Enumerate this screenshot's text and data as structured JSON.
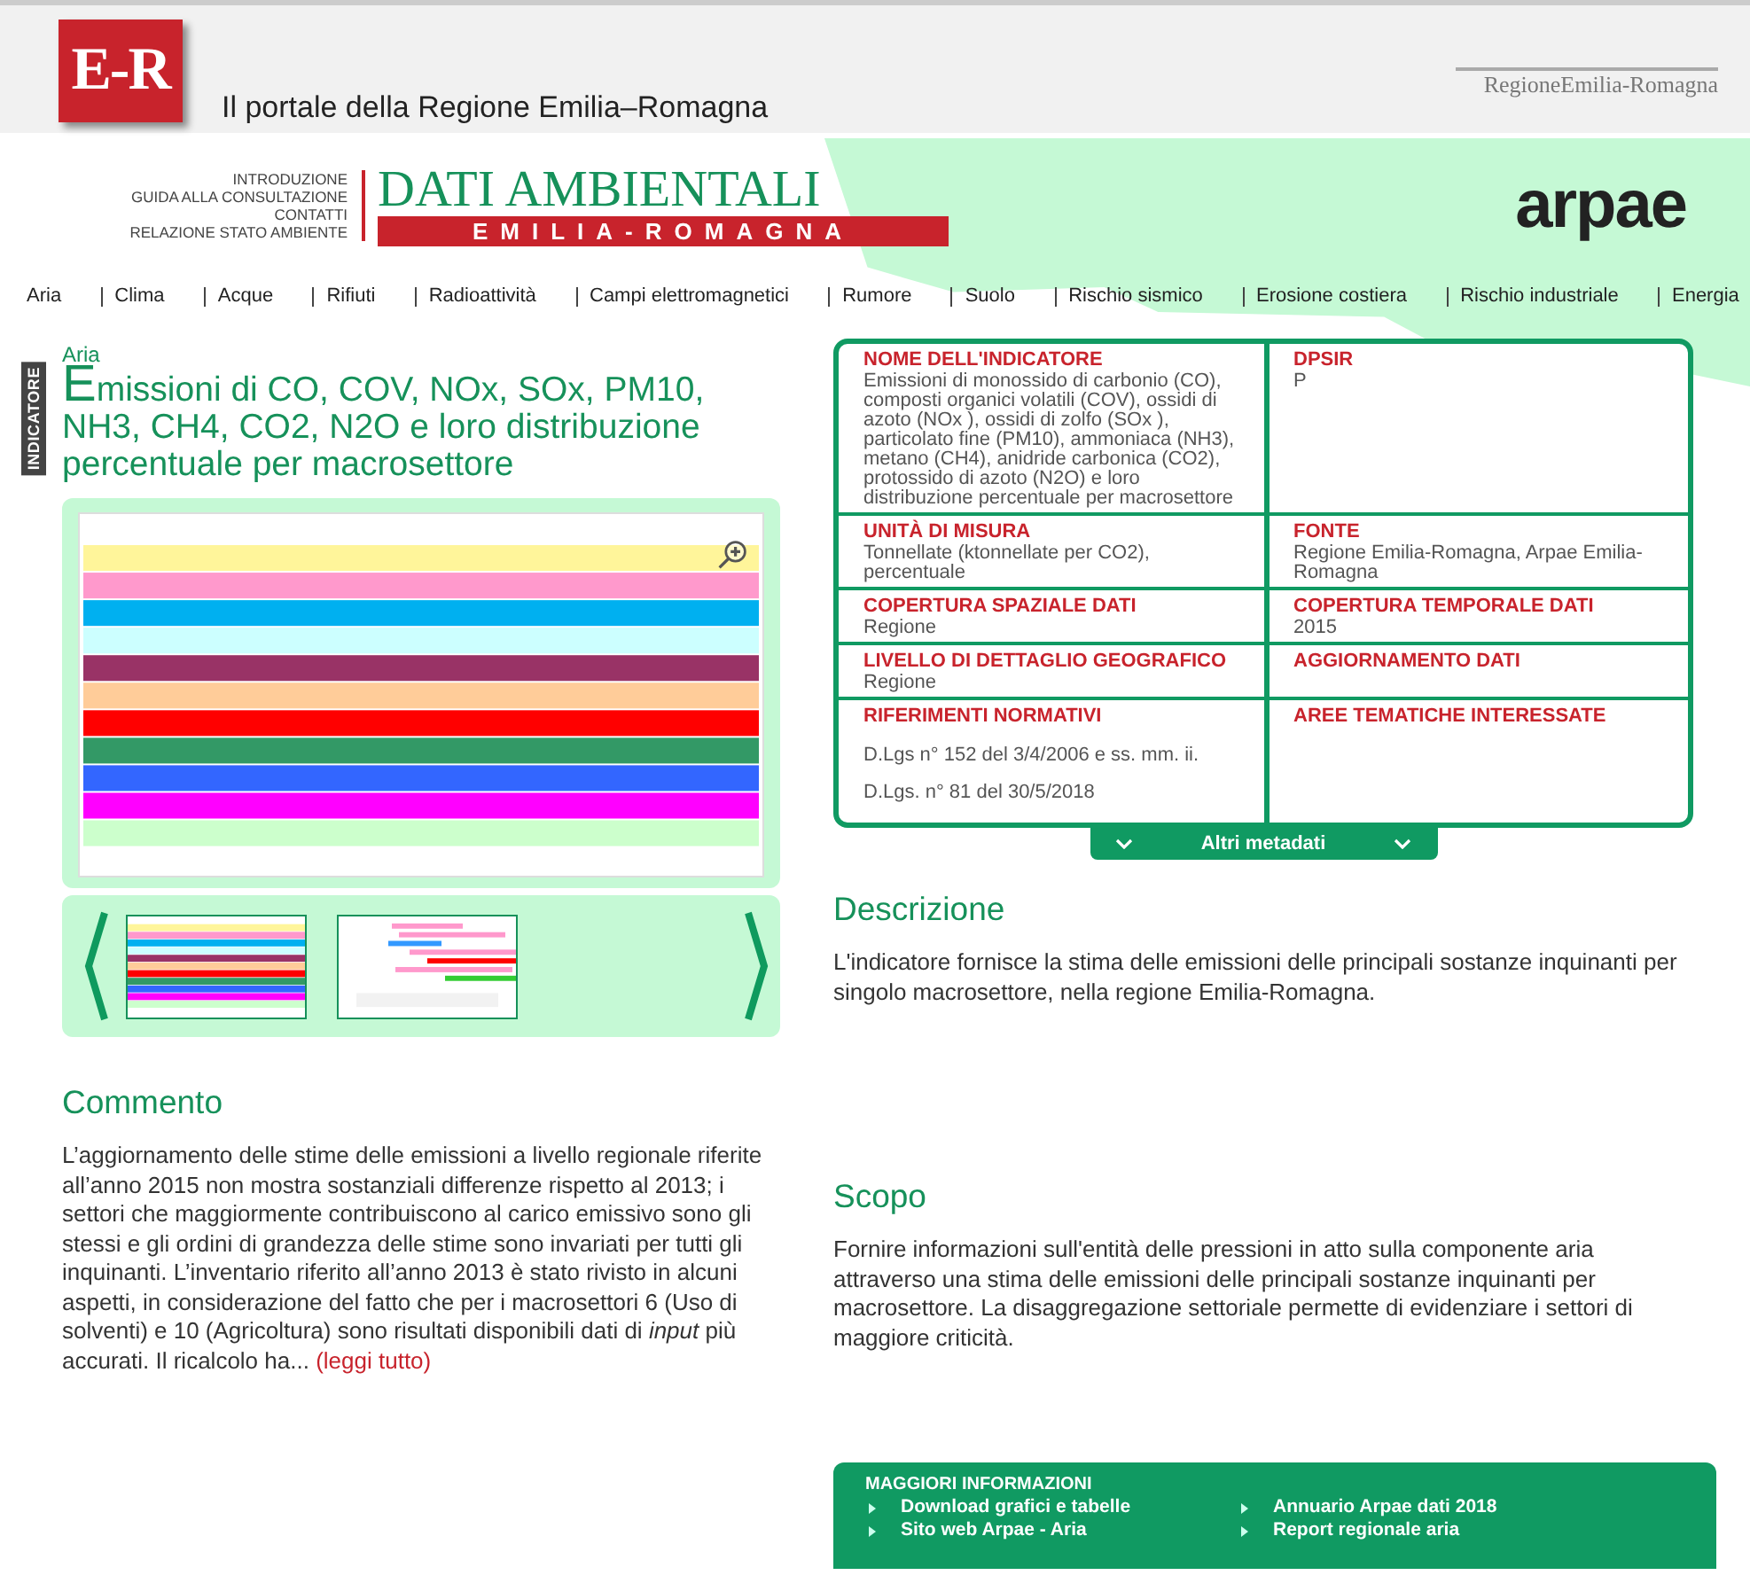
{
  "portal": {
    "logo_mark": "E-R",
    "title": "Il portale della Regione Emilia–Romagna",
    "region_logo": "RegioneEmilia-Romagna"
  },
  "site": {
    "links": [
      "INTRODUZIONE",
      "GUIDA ALLA CONSULTAZIONE",
      "CONTATTI",
      "RELAZIONE STATO AMBIENTE"
    ],
    "title": "DATI AMBIENTALI",
    "subtitle": "EMILIA-ROMAGNA",
    "agency_logo": "arpae"
  },
  "nav": [
    "Aria",
    "Clima",
    "Acque",
    "Rifiuti",
    "Radioattività",
    "Campi elettromagnetici",
    "Rumore",
    "Suolo",
    "Rischio sismico",
    "Erosione costiera",
    "Rischio industriale",
    "Energia"
  ],
  "indicator": {
    "side_label": "INDICATORE",
    "topic": "Aria",
    "title": "Emissioni di CO, COV, NOx, SOx, PM10, NH3, CH4, CO2, N2O e loro distribuzione percentuale per macrosettore"
  },
  "metadata": [
    {
      "label": "NOME DELL'INDICATORE",
      "lines": [
        "Emissioni di monossido di carbonio (CO), composti organici volatili (COV), ossidi di azoto (NOx ), ossidi di zolfo (SOx ), particolato fine (PM10), ammoniaca (NH3), metano (CH4), anidride carbonica (CO2), protossido di azoto (N2O) e loro distribuzione percentuale per macrosettore"
      ]
    },
    {
      "label": "DPSIR",
      "lines": [
        "P"
      ]
    },
    {
      "label": "UNITÀ DI MISURA",
      "lines": [
        "Tonnellate (ktonnellate per CO2), percentuale"
      ]
    },
    {
      "label": "FONTE",
      "lines": [
        "Regione Emilia-Romagna, Arpae Emilia-Romagna"
      ]
    },
    {
      "label": "COPERTURA SPAZIALE DATI",
      "lines": [
        "Regione"
      ]
    },
    {
      "label": "COPERTURA TEMPORALE DATI",
      "lines": [
        "2015"
      ]
    },
    {
      "label": "LIVELLO DI DETTAGLIO GEOGRAFICO",
      "lines": [
        "Regione"
      ]
    },
    {
      "label": "AGGIORNAMENTO DATI"
    },
    {
      "label": "RIFERIMENTI NORMATIVI",
      "kind": "list",
      "lines": [
        "D.Lgs n° 152 del 3/4/2006 e ss. mm. ii.",
        "D.Lgs. n° 81 del 30/5/2018"
      ]
    },
    {
      "label": "AREE TEMATICHE INTERESSATE"
    }
  ],
  "more_metadata_button": "Altri metadati",
  "comment": {
    "heading": "Commento",
    "text": "L’aggiornamento delle stime delle emissioni a livello regionale riferite all’anno 2015 non mostra sostanziali differenze rispetto al 2013; i settori che maggiormente contribuiscono al carico emissivo sono gli stessi e gli ordini di grandezza delle stime sono invariati per tutti gli inquinanti. L’inventario riferito all’anno 2013 è stato rivisto in alcuni aspetti, in considerazione del fatto che per i macrosettori 6 (Uso di solventi) e 10 (Agricoltura) sono risultati disponibili dati di *input* più accurati. Il ricalcolo ha...",
    "link": "(leggi tutto)"
  },
  "description": {
    "heading": "Descrizione",
    "text": "L'indicatore fornisce la stima delle emissioni delle principali sostanze inquinanti per singolo macrosettore, nella regione Emilia-Romagna."
  },
  "purpose": {
    "heading": "Scopo",
    "text": "Fornire informazioni sull'entità delle pressioni in atto sulla componente aria attraverso una stima delle emissioni delle principali sostanze inquinanti per macrosettore. La disaggregazione settoriale permette di evidenziare i settori di maggiore criticità."
  },
  "more_info": {
    "title": "MAGGIORI INFORMAZIONI",
    "links": [
      "Download grafici e tabelle",
      "Annuario Arpae dati 2018",
      "Sito web Arpae - Aria",
      "Report regionale aria"
    ]
  }
}
